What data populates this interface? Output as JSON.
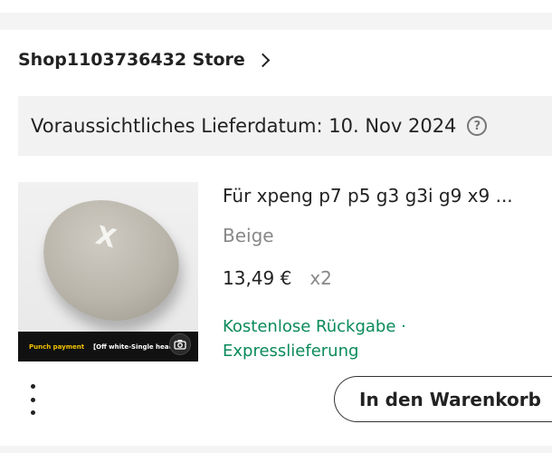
{
  "store": {
    "name": "Shop1103736432 Store"
  },
  "delivery": {
    "text": "Voraussichtliches Lieferdatum: 10. Nov 2024",
    "help_symbol": "?"
  },
  "product": {
    "title": "Für xpeng p7 p5 g3 g3i g9 x9 ...",
    "variant": "Beige",
    "price": "13,49 €",
    "quantity": "x2",
    "benefits": "Kostenlose Rückgabe · Expresslieferung",
    "image_caption_highlight": "Punch payment",
    "image_caption_text": "【Off white-Single head rest",
    "image_logo": "X"
  },
  "actions": {
    "add_to_cart_label": "In den Warenkorb"
  },
  "icons": {
    "chevron": "chevron-right-icon",
    "help": "question-circle-icon",
    "camera": "camera-icon",
    "more": "more-vertical-icon"
  },
  "colors": {
    "benefit_green": "#0a8a5a",
    "text": "#222222",
    "muted": "#888888"
  }
}
